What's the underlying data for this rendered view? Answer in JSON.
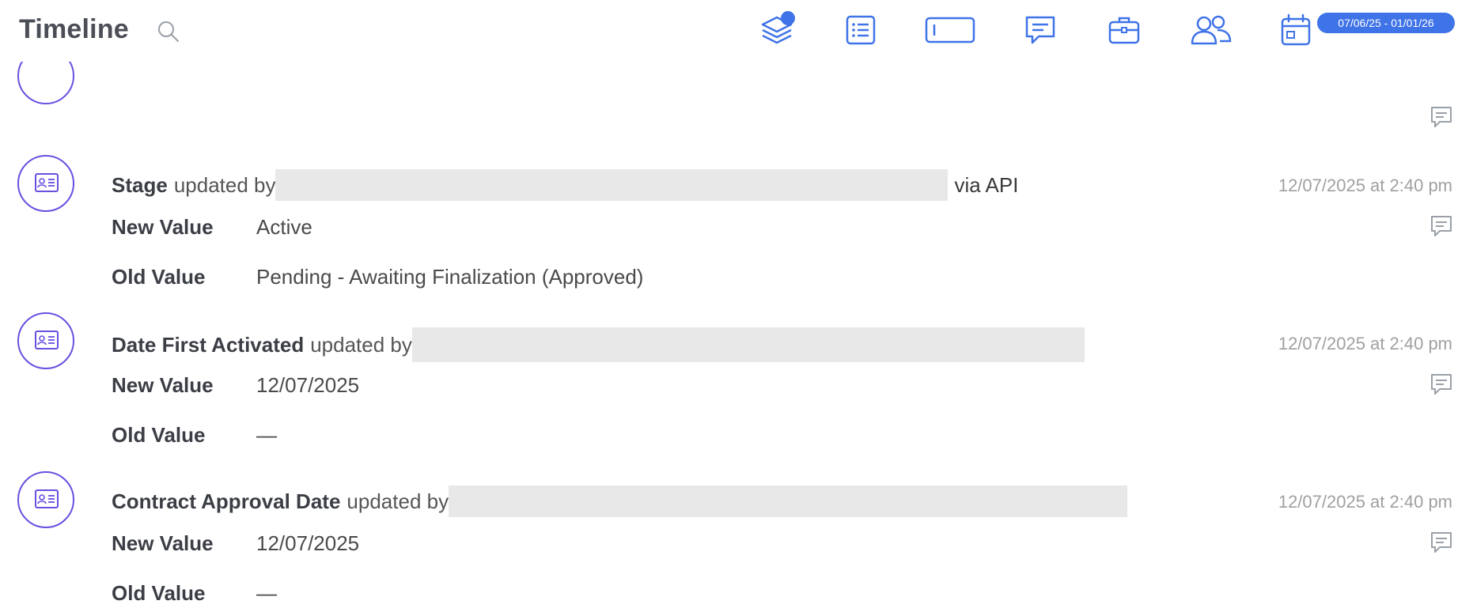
{
  "header": {
    "title": "Timeline",
    "toolbar_icons": [
      "layers-icon",
      "list-icon",
      "text-field-icon",
      "comment-icon",
      "briefcase-icon",
      "people-icon",
      "calendar-icon"
    ],
    "date_range": "07/06/25 - 01/01/26"
  },
  "colors": {
    "accent": "#3f73e8",
    "entry_icon_ring": "#6a4fe0",
    "redaction": "#e8e8e8",
    "timestamp": "#a0a0a0"
  },
  "entries": [
    {
      "field": "Stage",
      "updated_by_text": "updated by",
      "suffix": "via API",
      "timestamp": "12/07/2025 at 2:40 pm",
      "new_label": "New Value",
      "new_value": "Active",
      "old_label": "Old Value",
      "old_value": "Pending - Awaiting Finalization (Approved)"
    },
    {
      "field": "Date First Activated",
      "updated_by_text": "updated by",
      "timestamp": "12/07/2025 at 2:40 pm",
      "new_label": "New Value",
      "new_value": "12/07/2025",
      "old_label": "Old Value",
      "old_value": "—"
    },
    {
      "field": "Contract Approval Date",
      "updated_by_text": "updated by",
      "timestamp": "12/07/2025 at 2:40 pm",
      "new_label": "New Value",
      "new_value": "12/07/2025",
      "old_label": "Old Value",
      "old_value": "—"
    }
  ]
}
